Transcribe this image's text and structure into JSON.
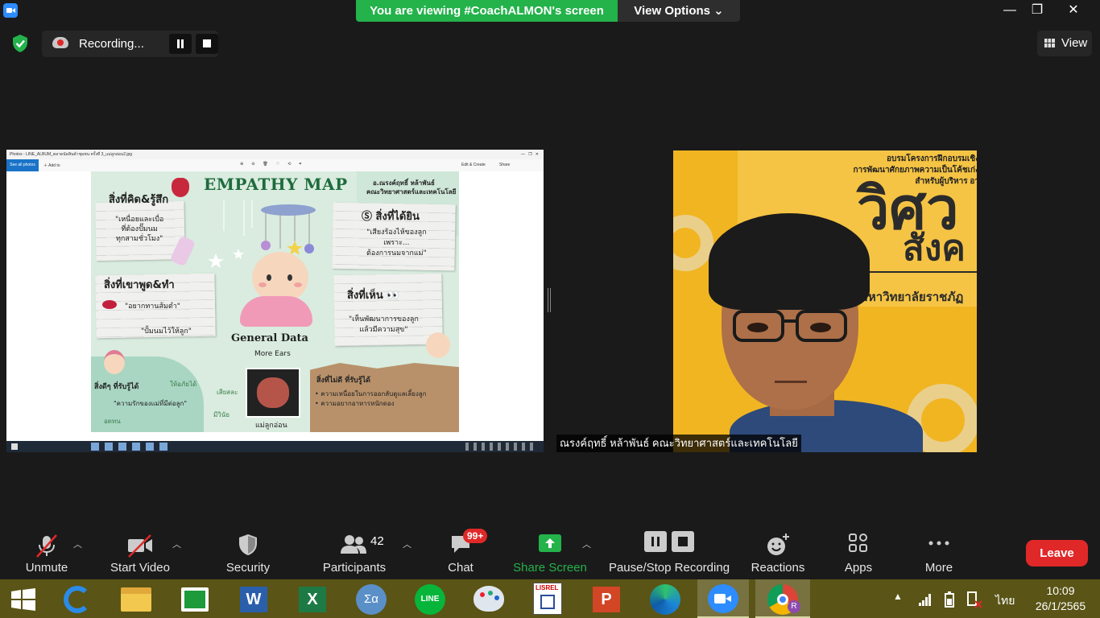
{
  "zoom": {
    "banner": "You are viewing #CoachALMON's screen",
    "view_options": "View Options",
    "recording_label": "Recording...",
    "view_label": "View",
    "participant_name": "ณรงค์ฤทธิ์ หล้าพันธ์ คณะวิทยาศาสตร์และเทคโนโลยี",
    "toolbar": {
      "unmute": "Unmute",
      "start_video": "Start Video",
      "security": "Security",
      "participants": "Participants",
      "participants_count": "42",
      "chat": "Chat",
      "chat_badge": "99+",
      "share_screen": "Share Screen",
      "pause_stop_recording": "Pause/Stop Recording",
      "reactions": "Reactions",
      "apps": "Apps",
      "more": "More",
      "leave": "Leave"
    },
    "colors": {
      "banner": "#24b24b",
      "share": "#24b24b",
      "leave": "#e02828",
      "badge": "#e02828",
      "shield": "#24b24b"
    }
  },
  "shared_screen": {
    "window_title": "Photos - LINE_ALBUM_ตลาดนัดสินค้าชุมชน ครั้งที่ 3_แม่ลูกอ่อน2.jpg",
    "see_all": "See all photos",
    "add_to": "Add to",
    "edit_create": "Edit & Create",
    "share": "Share",
    "poster": {
      "title": "EMPATHY MAP",
      "author": "อ.ณรงค์ฤทธิ์ หล้าพันธ์",
      "faculty": "คณะวิทยาศาสตร์และเทคโนโลยี",
      "think_feel": "สิ่งที่คิด&รู้สึก",
      "think_feel_quote": [
        "\"เหนื่อยและเบื่อ",
        "ที่ต้องปั๊มนม",
        "ทุกสามชั่วโมง\""
      ],
      "hear": "สิ่งที่ได้ยิน",
      "hear_quote": [
        "\"เสียงร้องไห้ของลูก",
        "เพราะ...",
        "ต้องการนมจากแม่\""
      ],
      "say_do": "สิ่งที่เขาพูด&ทำ",
      "say_do_quote_1": "\"อยากทานส้มตำ\"",
      "say_do_quote_2": "\"ปั้มนมไว้ให้ลูก\"",
      "see": "สิ่งที่เห็น",
      "see_quote": [
        "\"เห็นพัฒนาการของลูก",
        "แล้วมีความสุข\""
      ],
      "general_data": "General Data",
      "more_ears": "More Ears",
      "baby_caption": "แม่ลูกอ่อน",
      "gain": "สิ่งดีๆ ที่รับรู้ได้",
      "gain_quote": "\"ความรักของแม่ที่มีต่อลูก\"",
      "gain_words": [
        "ให้อภัยได้",
        "เสียสละ",
        "อดทน",
        "มีวินัย"
      ],
      "pain": "สิ่งที่ไม่ดี ที่รับรู้ได้",
      "pain_items": [
        "ความเหนื่อยในการออกลับดูแลเลี้ยงลูก",
        "ความอยากอาหารหนักดอง"
      ]
    }
  },
  "participant_video": {
    "bg_lines": [
      "อบรมโครงการฝึกอบรมเชิง",
      "การพัฒนาศักยภาพความเป็นโค้ชเก่ง",
      "สำหรับผู้บริหาร อา"
    ],
    "big_text_1": "วิศว",
    "big_text_2": "สังค",
    "university": "มหาวิทยาลัยราชภัฏ"
  },
  "taskbar": {
    "time": "10:09",
    "date": "26/1/2565",
    "lang": "ไทย",
    "apps": [
      "internet-explorer",
      "file-explorer",
      "store",
      "word",
      "excel",
      "calculator",
      "line",
      "paint",
      "lisrel",
      "powerpoint",
      "edge",
      "zoom",
      "chrome"
    ]
  }
}
